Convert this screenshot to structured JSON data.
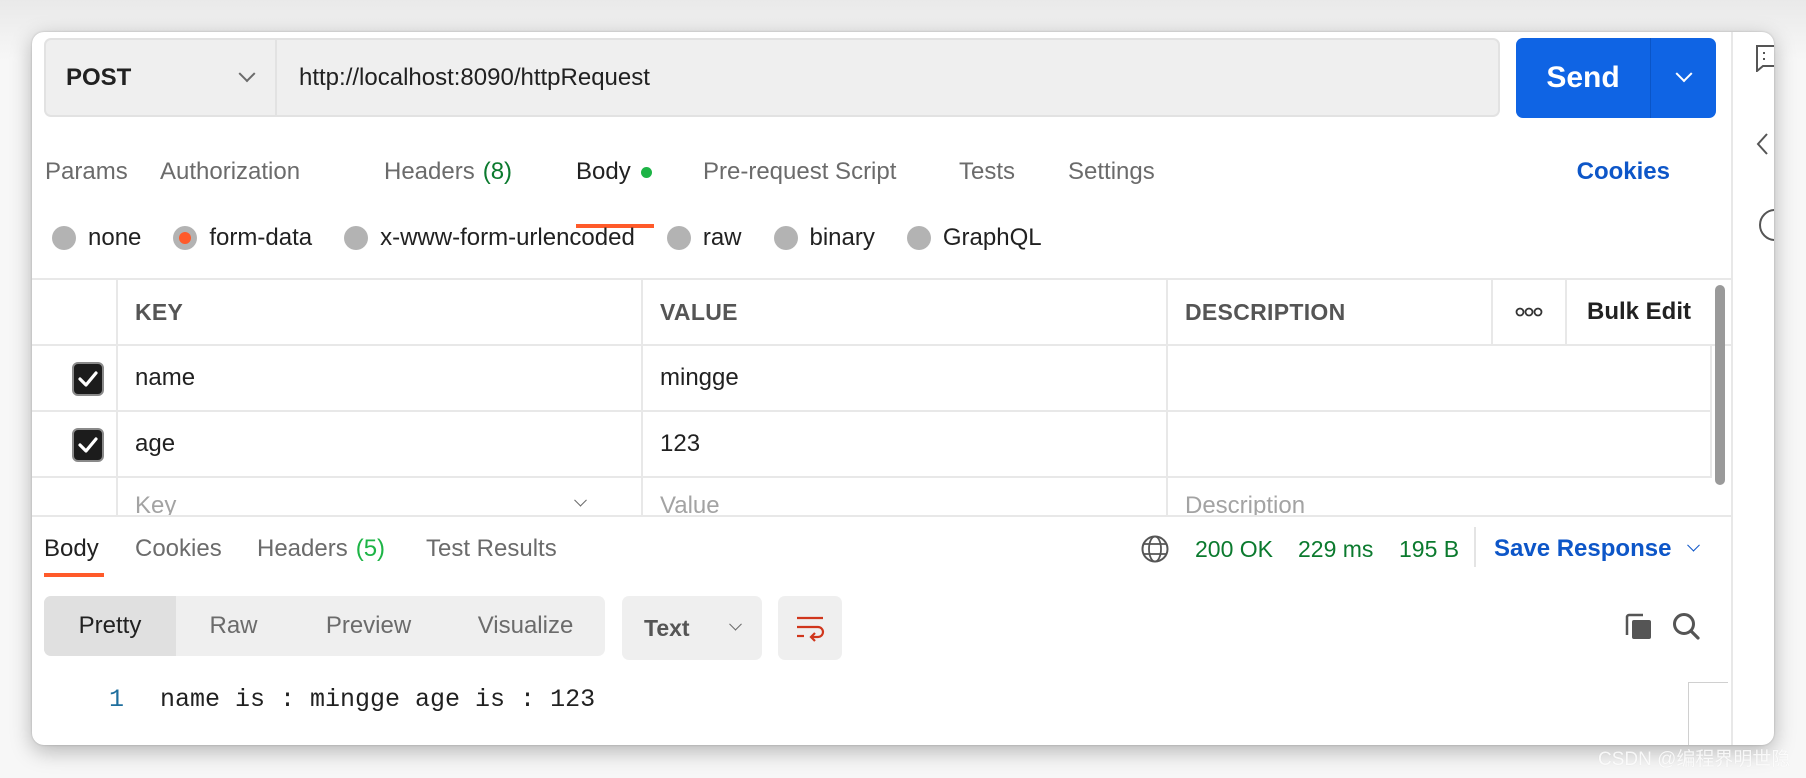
{
  "request": {
    "method": "POST",
    "url": "http://localhost:8090/httpRequest",
    "send_label": "Send"
  },
  "request_tabs": [
    {
      "label": "Params",
      "count": null,
      "active": false
    },
    {
      "label": "Authorization",
      "count": null,
      "active": false
    },
    {
      "label": "Headers",
      "count": "(8)",
      "active": false
    },
    {
      "label": "Body",
      "count": null,
      "active": true,
      "indicator": "modified-dot"
    },
    {
      "label": "Pre-request Script",
      "count": null,
      "active": false
    },
    {
      "label": "Tests",
      "count": null,
      "active": false
    },
    {
      "label": "Settings",
      "count": null,
      "active": false
    }
  ],
  "cookies_label": "Cookies",
  "body_types": [
    {
      "label": "none",
      "selected": false
    },
    {
      "label": "form-data",
      "selected": true
    },
    {
      "label": "x-www-form-urlencoded",
      "selected": false
    },
    {
      "label": "raw",
      "selected": false
    },
    {
      "label": "binary",
      "selected": false
    },
    {
      "label": "GraphQL",
      "selected": false
    }
  ],
  "form_table": {
    "headers": {
      "key": "KEY",
      "value": "VALUE",
      "description": "DESCRIPTION",
      "more": "ooo",
      "bulk_edit": "Bulk Edit"
    },
    "rows": [
      {
        "checked": true,
        "key": "name",
        "value": "mingge",
        "description": ""
      },
      {
        "checked": true,
        "key": "age",
        "value": "123",
        "description": ""
      }
    ],
    "placeholders": {
      "key": "Key",
      "value": "Value",
      "description": "Description"
    }
  },
  "response": {
    "tabs": [
      {
        "label": "Body",
        "count": null,
        "active": true
      },
      {
        "label": "Cookies",
        "count": null,
        "active": false
      },
      {
        "label": "Headers",
        "count": "(5)",
        "active": false
      },
      {
        "label": "Test Results",
        "count": null,
        "active": false
      }
    ],
    "status": "200 OK",
    "time": "229 ms",
    "size": "195 B",
    "save_label": "Save Response",
    "view_modes": [
      "Pretty",
      "Raw",
      "Preview",
      "Visualize"
    ],
    "active_view": "Pretty",
    "format": "Text",
    "lines": [
      {
        "no": "1",
        "text": "name is : mingge age is : 123"
      }
    ]
  },
  "colors": {
    "send": "#0f64e4",
    "accent": "#ff5a2a",
    "link": "#0d56c8",
    "status_ok": "#0b7a2e",
    "count_green": "#1db446"
  },
  "watermark": "CSDN @编程界明世隐"
}
